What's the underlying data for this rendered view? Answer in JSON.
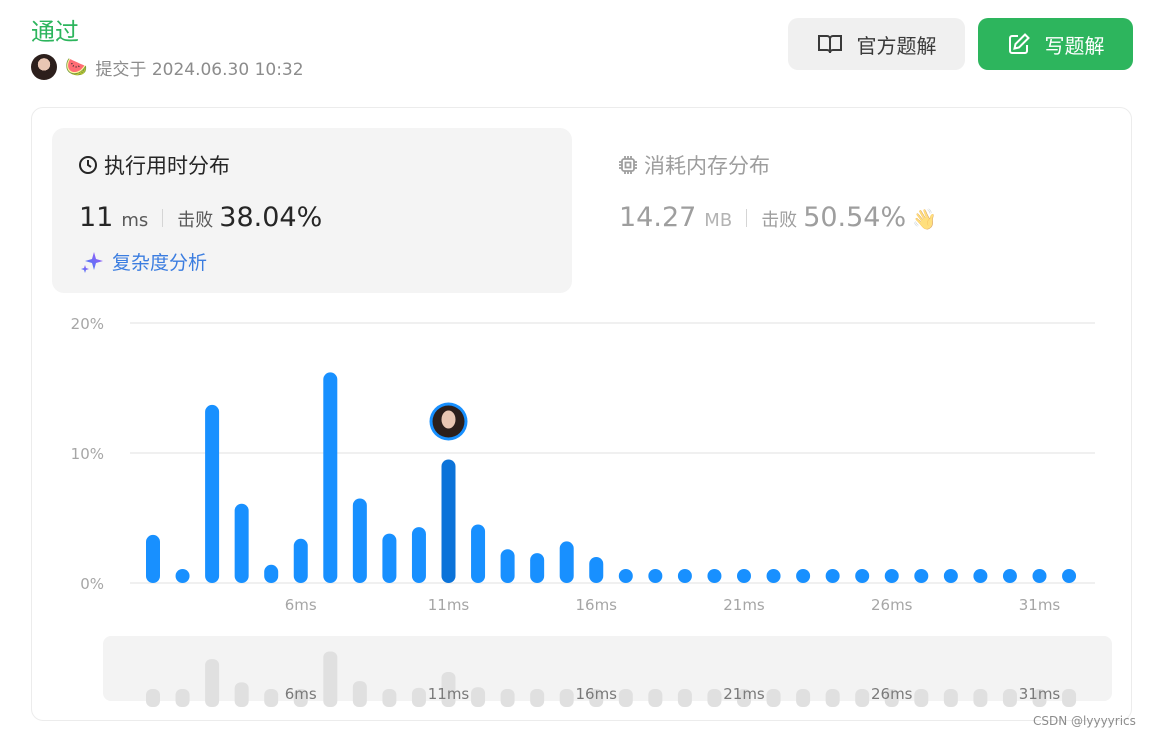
{
  "header": {
    "status": "通过",
    "watermelon_emoji": "🍉",
    "submitted_text": "提交于 2024.06.30 10:32"
  },
  "buttons": {
    "official_solution": "官方题解",
    "write_solution": "写题解"
  },
  "runtime": {
    "title": "执行用时分布",
    "value": "11",
    "unit": "ms",
    "beat_label": "击败",
    "beat_value": "38.04%",
    "analysis_label": "复杂度分析"
  },
  "memory": {
    "title": "消耗内存分布",
    "value": "14.27",
    "unit": "MB",
    "beat_label": "击败",
    "beat_value": "50.54%",
    "wave_emoji": "👋"
  },
  "watermark": "CSDN @lyyyyrics",
  "colors": {
    "accent_green": "#2db55d",
    "bar_blue": "#1890ff",
    "bar_highlight": "#0b73d9",
    "overview_bar": "#e0e0e0"
  },
  "chart_data": {
    "type": "bar",
    "x": [
      1,
      2,
      3,
      4,
      5,
      6,
      7,
      8,
      9,
      10,
      11,
      12,
      13,
      14,
      15,
      16,
      17,
      18,
      19,
      20,
      21,
      22,
      23,
      24,
      25,
      26,
      27,
      28,
      29,
      30,
      31,
      32
    ],
    "values": [
      3.7,
      0.5,
      13.7,
      6.1,
      1.4,
      3.4,
      16.2,
      6.5,
      3.8,
      4.3,
      9.5,
      4.5,
      2.6,
      2.3,
      3.2,
      2.0,
      0.9,
      1.0,
      0.9,
      0.6,
      0.5,
      0.5,
      0.5,
      0.5,
      0.5,
      0.5,
      0.5,
      0.5,
      0.5,
      0.5,
      0.5,
      0.5
    ],
    "highlight_x": 11,
    "yticks": [
      "0%",
      "10%",
      "20%"
    ],
    "ylim": [
      0,
      20
    ],
    "xticks": [
      {
        "x": 6,
        "label": "6ms"
      },
      {
        "x": 11,
        "label": "11ms"
      },
      {
        "x": 16,
        "label": "16ms"
      },
      {
        "x": 21,
        "label": "21ms"
      },
      {
        "x": 26,
        "label": "26ms"
      },
      {
        "x": 31,
        "label": "31ms"
      }
    ],
    "grid": true
  }
}
